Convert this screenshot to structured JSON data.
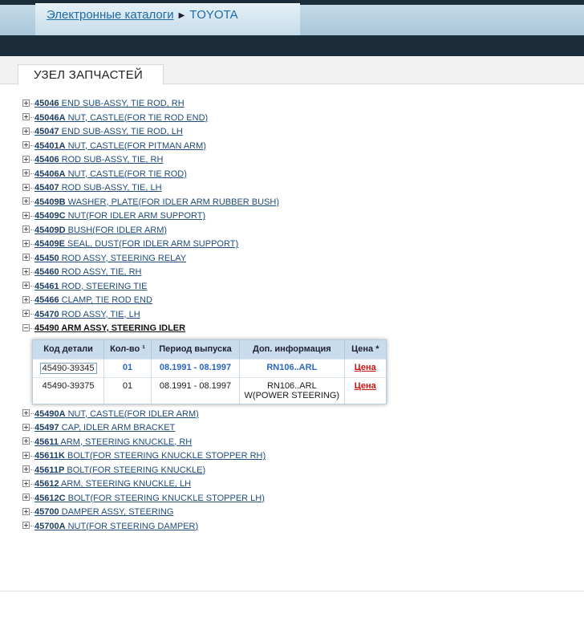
{
  "breadcrumb": {
    "catalogs_link": "Электронные каталоги",
    "separator": "▶",
    "brand": "TOYOTA"
  },
  "section": {
    "tab_title": "УЗЕЛ ЗАПЧАСТЕЙ"
  },
  "tree_before": [
    {
      "code": "45046",
      "name": " END SUB-ASSY, TIE ROD, RH"
    },
    {
      "code": "45046A",
      "name": " NUT, CASTLE(FOR TIE ROD END)"
    },
    {
      "code": "45047",
      "name": " END SUB-ASSY, TIE ROD, LH"
    },
    {
      "code": "45401A",
      "name": " NUT, CASTLE(FOR PITMAN ARM)"
    },
    {
      "code": "45406",
      "name": " ROD SUB-ASSY, TIE, RH"
    },
    {
      "code": "45406A",
      "name": " NUT, CASTLE(FOR TIE ROD)"
    },
    {
      "code": "45407",
      "name": " ROD SUB-ASSY, TIE, LH"
    },
    {
      "code": "45409B",
      "name": " WASHER, PLATE(FOR IDLER ARM RUBBER BUSH)"
    },
    {
      "code": "45409C",
      "name": " NUT(FOR IDLER ARM SUPPORT)"
    },
    {
      "code": "45409D",
      "name": " BUSH(FOR IDLER ARM)"
    },
    {
      "code": "45409E",
      "name": " SEAL, DUST(FOR IDLER ARM SUPPORT)"
    },
    {
      "code": "45450",
      "name": " ROD ASSY, STEERING RELAY"
    },
    {
      "code": "45460",
      "name": " ROD ASSY, TIE, RH"
    },
    {
      "code": "45461",
      "name": " ROD, STEERING TIE"
    },
    {
      "code": "45466",
      "name": " CLAMP, TIE ROD END"
    },
    {
      "code": "45470",
      "name": " ROD ASSY, TIE, LH"
    }
  ],
  "open_item": {
    "code": "45490",
    "name": " ARM ASSY, STEERING IDLER"
  },
  "parts_table": {
    "headers": {
      "code": "Код детали",
      "qty": "Кол-во ¹",
      "period": "Период выпуска",
      "info": "Доп. информация",
      "price": "Цена *"
    },
    "rows": [
      {
        "code": "45490-39345",
        "qty": "01",
        "period": "08.1991 - 08.1997",
        "info1": "RN106..ARL",
        "info2": "",
        "price": "Цена"
      },
      {
        "code": "45490-39375",
        "qty": "01",
        "period": "08.1991 - 08.1997",
        "info1": "RN106..ARL",
        "info2": "W(POWER STEERING)",
        "price": "Цена"
      }
    ]
  },
  "tree_after": [
    {
      "code": "45490A",
      "name": " NUT, CASTLE(FOR IDLER ARM)"
    },
    {
      "code": "45497",
      "name": " CAP, IDLER ARM BRACKET"
    },
    {
      "code": "45611",
      "name": " ARM, STEERING KNUCKLE, RH"
    },
    {
      "code": "45611K",
      "name": " BOLT(FOR STEERING KNUCKLE STOPPER RH)"
    },
    {
      "code": "45611P",
      "name": " BOLT(FOR STEERING KNUCKLE)"
    },
    {
      "code": "45612",
      "name": " ARM, STEERING KNUCKLE, LH"
    },
    {
      "code": "45612C",
      "name": " BOLT(FOR STEERING KNUCKLE STOPPER LH)"
    },
    {
      "code": "45700",
      "name": " DAMPER ASSY, STEERING"
    },
    {
      "code": "45700A",
      "name": " NUT(FOR STEERING DAMPER)"
    }
  ]
}
